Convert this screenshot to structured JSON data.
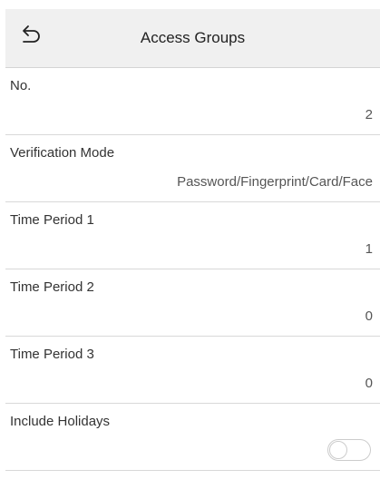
{
  "header": {
    "title": "Access Groups",
    "back_icon": "back-arrow-icon"
  },
  "rows": [
    {
      "label": "No.",
      "value": "2"
    },
    {
      "label": "Verification Mode",
      "value": "Password/Fingerprint/Card/Face"
    },
    {
      "label": "Time Period 1",
      "value": "1"
    },
    {
      "label": "Time Period 2",
      "value": "0"
    },
    {
      "label": "Time Period 3",
      "value": "0"
    },
    {
      "label": "Include Holidays",
      "toggle_on": false
    }
  ],
  "colors": {
    "header_bg": "#f0f0f0",
    "divider": "#d8d8d8",
    "toggle_border": "#cccccc"
  }
}
